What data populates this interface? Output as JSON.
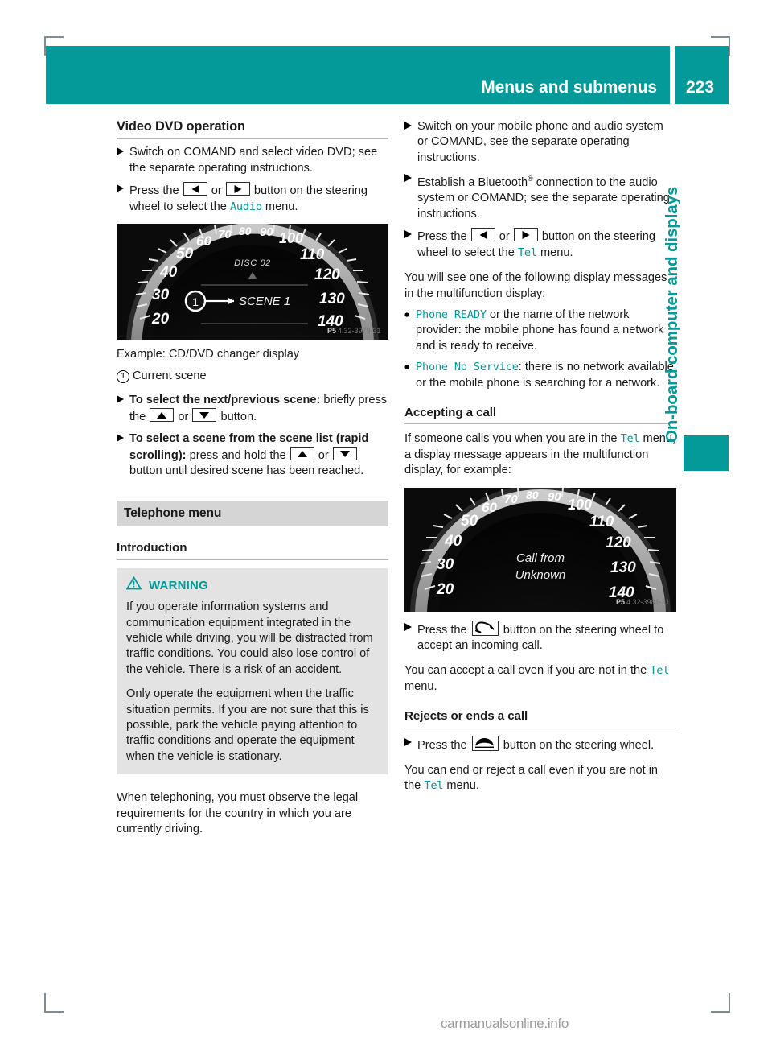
{
  "header": {
    "title": "Menus and submenus",
    "page_number": "223",
    "accent_color": "#049a9a"
  },
  "side_tab": {
    "label": "On-board computer and displays"
  },
  "left_column": {
    "heading": "Video DVD operation",
    "steps": [
      {
        "marker": "X",
        "text_parts": [
          "Switch on COMAND and select video DVD; see the separate operating instructions."
        ]
      },
      {
        "marker": "X",
        "prefix": "Press the ",
        "mid": " or ",
        "suffix": " button on the steering wheel to select the ",
        "token": "Audio",
        "end": " menu."
      }
    ],
    "image_caption": "Example: CD/DVD changer display",
    "legend": {
      "number": "1",
      "text": "Current scene"
    },
    "scene_steps": [
      {
        "marker": "X",
        "bold": "To select the next/previous scene:",
        "rest_prefix": " briefly press the ",
        "rest_mid": " or ",
        "rest_suffix": " button."
      },
      {
        "marker": "X",
        "bold1": "To select a scene from the scene list (rapid scrolling):",
        "rest_prefix": " press and hold the ",
        "rest_mid": " or ",
        "rest_suffix": " button until desired scene has been reached."
      }
    ],
    "section_bar": "Telephone menu",
    "subheading": "Introduction",
    "warning": {
      "title": "WARNING",
      "icon": "warning-triangle-icon",
      "paragraphs": [
        "If you operate information systems and communication equipment integrated in the vehicle while driving, you will be distracted from traffic conditions. You could also lose control of the vehicle. There is a risk of an accident.",
        "Only operate the equipment when the traffic situation permits. If you are not sure that this is possible, park the vehicle paying attention to traffic conditions and operate the equipment when the vehicle is stationary."
      ]
    },
    "closing_paragraph": "When telephoning, you must observe the legal requirements for the country in which you are currently driving."
  },
  "right_column": {
    "steps": [
      {
        "marker": "X",
        "text": "Switch on your mobile phone and audio system or COMAND, see the separate operating instructions."
      },
      {
        "marker": "X",
        "text_a": "Establish a Bluetooth",
        "sup": "®",
        "text_b": " connection to the audio system or COMAND; see the separate operating instructions."
      },
      {
        "marker": "X",
        "prefix": "Press the ",
        "mid": " or ",
        "suffix": " button on the steering wheel to select the ",
        "token": "Tel",
        "end": " menu."
      }
    ],
    "intro_paragraph": "You will see one of the following display messages in the multifunction display:",
    "bullets": [
      {
        "marker": "R",
        "token": "Phone READY",
        "text": " or the name of the network provider: the mobile phone has found a network and is ready to receive."
      },
      {
        "marker": "R",
        "token": "Phone No Service",
        "text": ": there is no network available or the mobile phone is searching for a network."
      }
    ],
    "accept_heading": "Accepting a call",
    "accept_intro_a": "If someone calls you when you are in the ",
    "accept_token": "Tel",
    "accept_intro_b": " menu, a display message appears in the multifunction display, for example:",
    "accept_step": {
      "marker": "X",
      "prefix": "Press the ",
      "suffix": " button on the steering wheel to accept an incoming call."
    },
    "accept_note_a": "You can accept a call even if you are not in the ",
    "accept_note_token": "Tel",
    "accept_note_b": " menu.",
    "reject_heading": "Rejects or ends a call",
    "reject_step": {
      "marker": "X",
      "prefix": "Press the ",
      "suffix": " button on the steering wheel."
    },
    "reject_note_a": "You can end or reject a call even if you are not in the ",
    "reject_note_token": "Tel",
    "reject_note_b": " menu."
  },
  "cluster_left": {
    "disc_label": "DISC 02",
    "scene_label": "SCENE 1",
    "code": "P54.32-3979-31",
    "speed_ticks": [
      "20",
      "30",
      "40",
      "50",
      "60",
      "70",
      "80",
      "90",
      "100",
      "110",
      "120",
      "130",
      "140"
    ]
  },
  "cluster_right": {
    "message_line1": "Call from",
    "message_line2": "Unknown",
    "code": "P54.32-3981-31",
    "speed_ticks": [
      "20",
      "30",
      "40",
      "50",
      "60",
      "70",
      "80",
      "90",
      "100",
      "110",
      "120",
      "130",
      "140"
    ]
  },
  "watermark": "carmanualsonline.info"
}
